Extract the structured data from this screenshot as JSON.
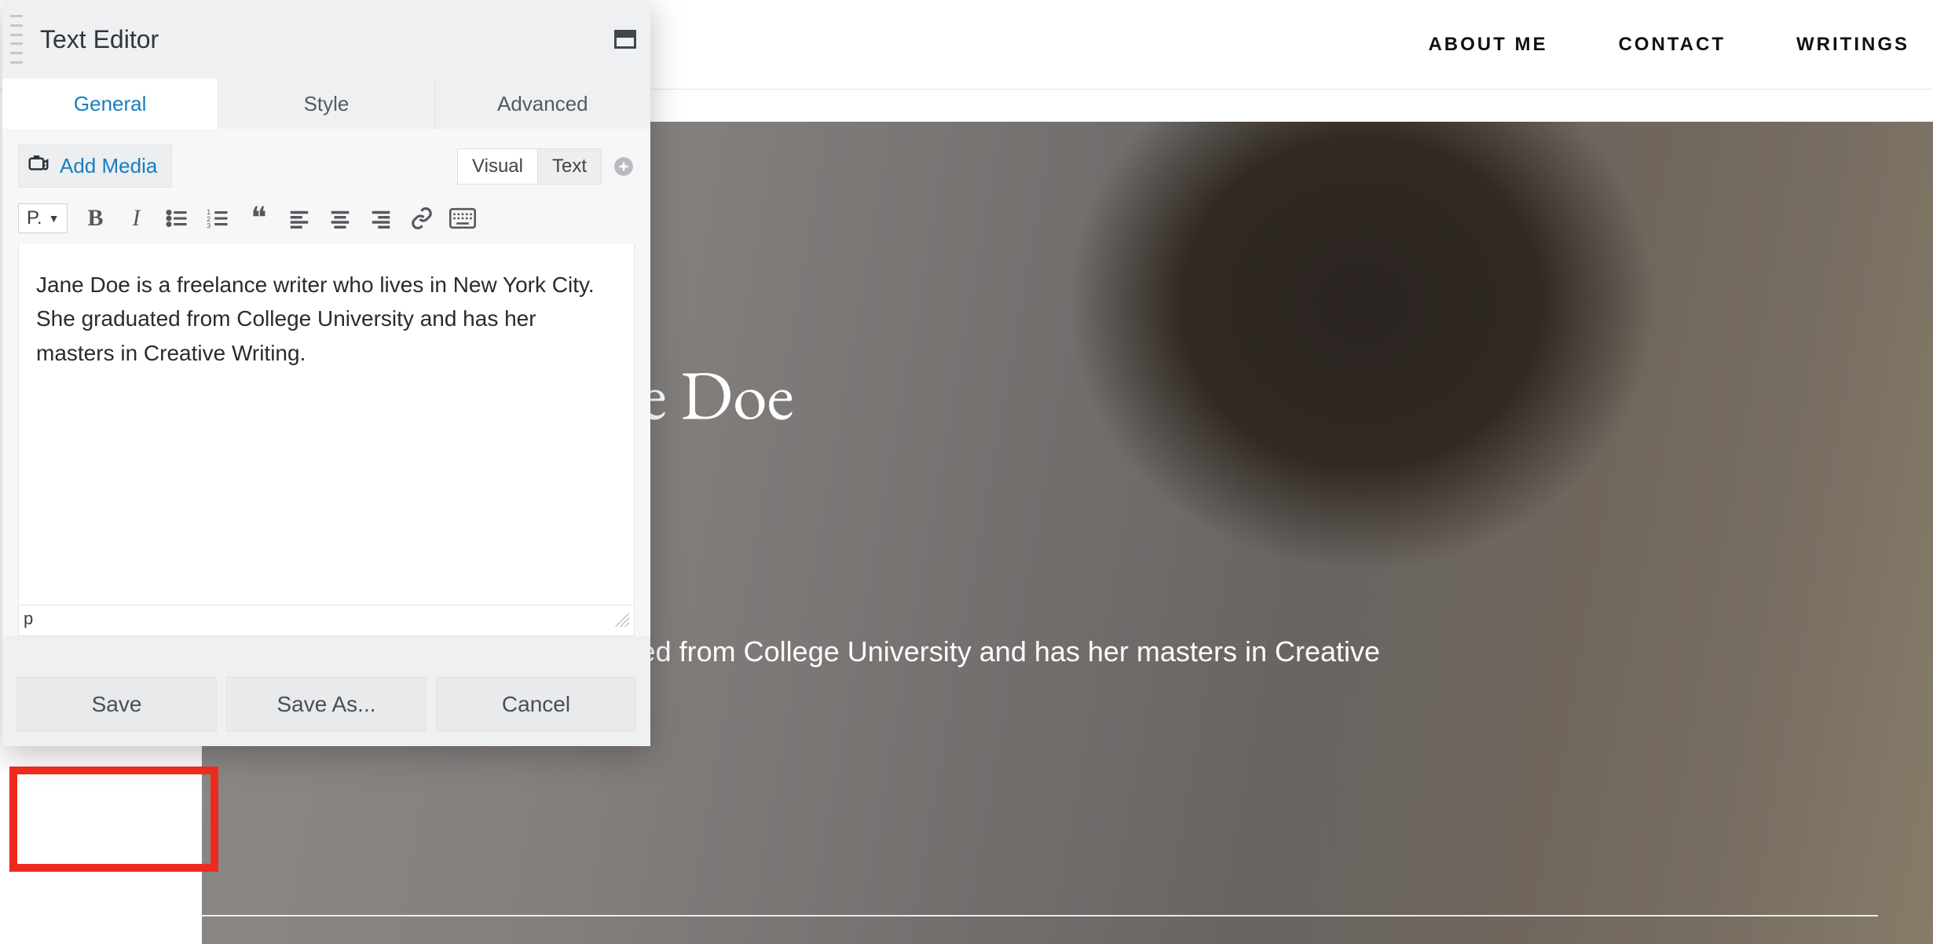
{
  "nav": {
    "items": [
      {
        "label": "ABOUT ME"
      },
      {
        "label": "CONTACT"
      },
      {
        "label": "WRITINGS"
      }
    ]
  },
  "hero": {
    "title": "Jane Doe",
    "description_visible": "lives in New York City. She graduated from College University and has her masters in Creative"
  },
  "editor": {
    "panel_title": "Text Editor",
    "tabs": {
      "general": "General",
      "style": "Style",
      "advanced": "Advanced"
    },
    "add_media_label": "Add Media",
    "mode_tabs": {
      "visual": "Visual",
      "text": "Text"
    },
    "paragraph_selector": "P.",
    "content": "Jane Doe is a freelance writer who lives in New York City. She graduated from College University and has her masters in Creative Writing.",
    "status_path": "p",
    "actions": {
      "save": "Save",
      "save_as": "Save As...",
      "cancel": "Cancel"
    }
  },
  "icons": {
    "media": "camera-music-icon",
    "bold": "bold-icon",
    "italic": "italic-icon",
    "ul": "bullet-list-icon",
    "ol": "numbered-list-icon",
    "quote": "blockquote-icon",
    "align_left": "align-left-icon",
    "align_center": "align-center-icon",
    "align_right": "align-right-icon",
    "link": "link-icon",
    "keyboard": "keyboard-icon",
    "plus": "plus-circle-icon",
    "expand": "expand-window-icon"
  },
  "colors": {
    "accent": "#187ebf",
    "highlight": "#ec2b1e"
  }
}
